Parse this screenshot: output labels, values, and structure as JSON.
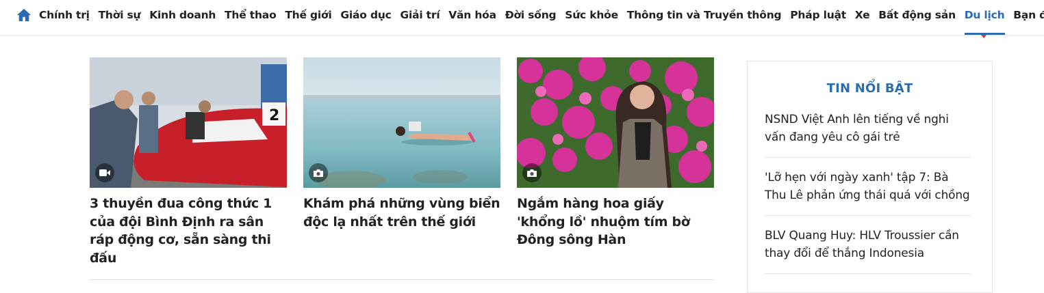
{
  "nav": {
    "home_icon": "home-icon",
    "items": [
      {
        "label": "Chính trị"
      },
      {
        "label": "Thời sự"
      },
      {
        "label": "Kinh doanh"
      },
      {
        "label": "Thể thao"
      },
      {
        "label": "Thế giới"
      },
      {
        "label": "Giáo dục"
      },
      {
        "label": "Giải trí"
      },
      {
        "label": "Văn hóa"
      },
      {
        "label": "Đời sống"
      },
      {
        "label": "Sức khỏe"
      },
      {
        "label": "Thông tin và Truyền thông"
      },
      {
        "label": "Pháp luật"
      },
      {
        "label": "Xe"
      },
      {
        "label": "Bất động sản"
      },
      {
        "label": "Du lịch",
        "active": true
      },
      {
        "label": "Bạn đọc"
      }
    ],
    "accent_color": "#2b6cb0"
  },
  "articles": [
    {
      "title": "3 thuyền đua công thức 1 của đội Bình Định ra sân ráp động cơ, sẵn sàng thi đấu",
      "media_icon": "video-icon"
    },
    {
      "title": "Khám phá những vùng biển độc lạ nhất trên thế giới",
      "media_icon": "camera-icon"
    },
    {
      "title": "Ngắm hàng hoa giấy 'khổng lồ' nhuộm tím bờ Đông sông Hàn",
      "media_icon": "camera-icon"
    }
  ],
  "sidebar": {
    "heading": "TIN NỔI BẬT",
    "items": [
      {
        "title": "NSND Việt Anh lên tiếng về nghi vấn đang yêu cô gái trẻ"
      },
      {
        "title": "'Lỡ hẹn với ngày xanh' tập 7: Bà Thu Lê phản ứng thái quá với chồng"
      },
      {
        "title": "BLV Quang Huy: HLV Troussier cần thay đổi để thắng Indonesia"
      }
    ]
  }
}
